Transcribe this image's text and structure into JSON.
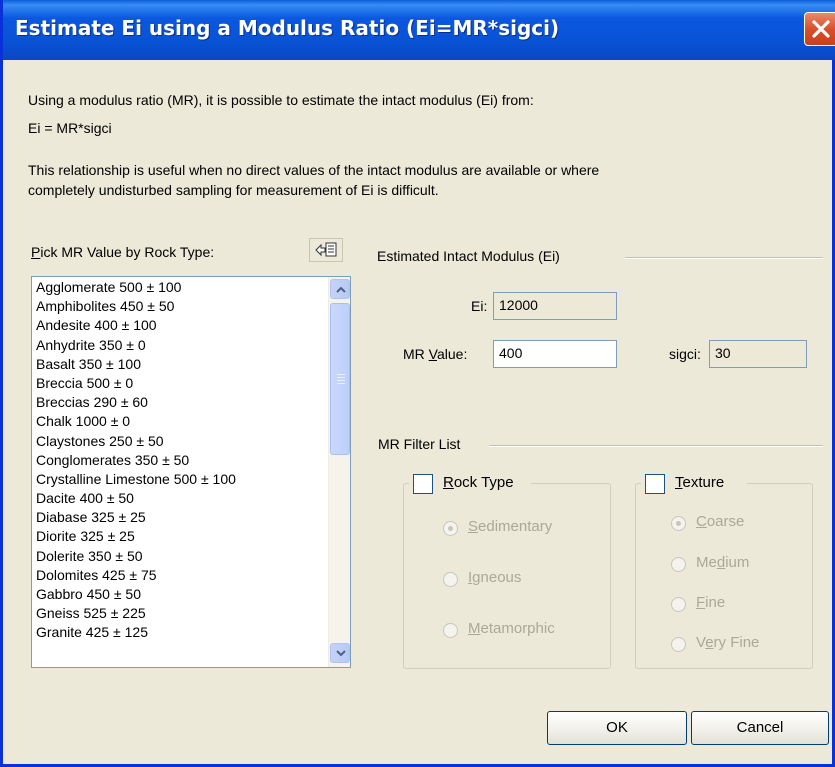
{
  "window": {
    "title": "Estimate Ei using a Modulus Ratio (Ei=MR*sigci)"
  },
  "intro": {
    "line1": "Using a modulus ratio (MR), it is possible to estimate the intact modulus (Ei) from:",
    "formula": "Ei = MR*sigci",
    "para1": "This relationship is useful when no direct values of the intact modulus are available or where",
    "para2": "completely undisturbed sampling for measurement of Ei is difficult."
  },
  "rock_list": {
    "label_mnemonic": "P",
    "label_rest": "ick MR Value by Rock Type:",
    "toolbar_icon": "copy-to-clipboard-icon",
    "items": [
      "Agglomerate   500 ± 100",
      "Amphibolites   450 ± 50",
      "Andesite   400 ± 100",
      "Anhydrite   350 ± 0",
      "Basalt   350 ± 100",
      "Breccia   500 ± 0",
      "Breccias   290 ± 60",
      "Chalk   1000 ± 0",
      "Claystones   250 ± 50",
      "Conglomerates   350 ± 50",
      "Crystalline Limestone   500 ± 100",
      "Dacite   400 ± 50",
      "Diabase   325 ± 25",
      "Diorite   325 ± 25",
      "Dolerite   350 ± 50",
      "Dolomites   425 ± 75",
      "Gabbro   450 ± 50",
      "Gneiss   525 ± 225",
      "Granite   425 ± 125"
    ]
  },
  "estimate": {
    "section_label": "Estimated Intact Modulus (Ei)",
    "ei_label": "Ei:",
    "ei_value": "12000",
    "mr_label_pre": "MR ",
    "mr_label_mnemonic": "V",
    "mr_label_post": "alue:",
    "mr_value": "400",
    "sigci_label": "sigci:",
    "sigci_value": "30"
  },
  "filter": {
    "section_label": "MR Filter List",
    "rock_type": {
      "mnemonic": "R",
      "rest": "ock Type",
      "checked": false,
      "options": [
        {
          "mnemonic": "S",
          "rest": "edimentary",
          "selected": true
        },
        {
          "mnemonic": "I",
          "rest": "gneous",
          "selected": false
        },
        {
          "mnemonic": "M",
          "rest": "etamorphic",
          "selected": false
        }
      ]
    },
    "texture": {
      "mnemonic": "T",
      "rest": "exture",
      "checked": false,
      "options": [
        {
          "pre": "",
          "mnemonic": "C",
          "rest": "oarse",
          "selected": true
        },
        {
          "pre": "Me",
          "mnemonic": "d",
          "rest": "ium",
          "selected": false
        },
        {
          "pre": "",
          "mnemonic": "F",
          "rest": "ine",
          "selected": false
        },
        {
          "pre": "V",
          "mnemonic": "e",
          "rest": "ry Fine",
          "selected": false
        }
      ]
    }
  },
  "buttons": {
    "ok": "OK",
    "cancel": "Cancel"
  },
  "colors": {
    "titlebar": "#0852d4",
    "dialog_bg": "#ece9d8",
    "close": "#d9512c",
    "disabled_text": "#aca899"
  }
}
